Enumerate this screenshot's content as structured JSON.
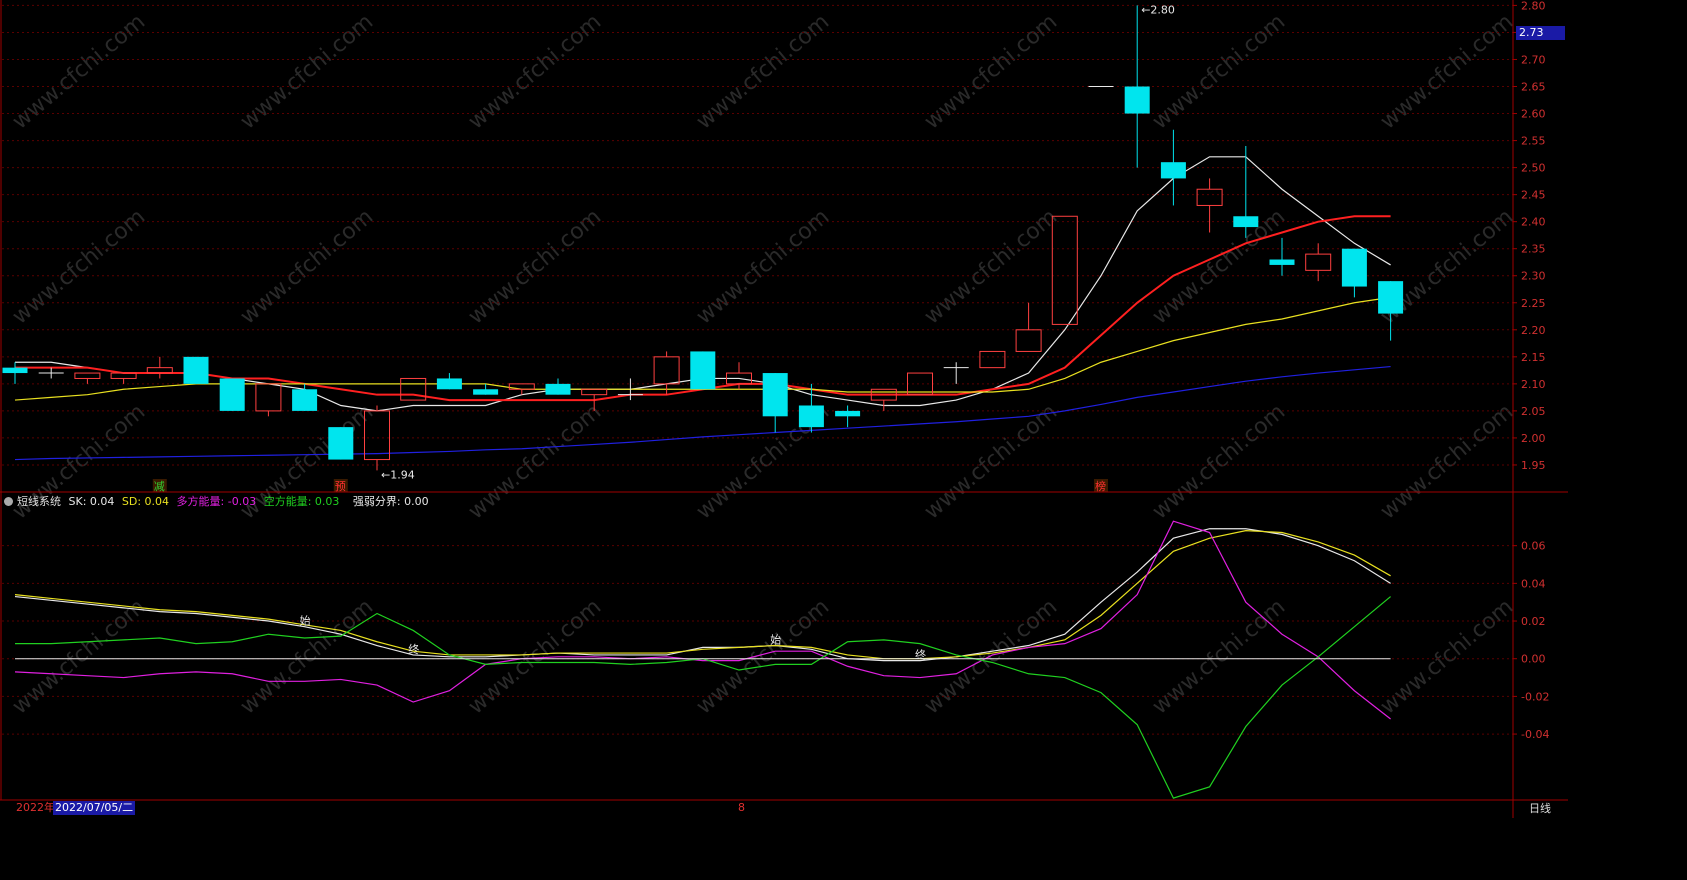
{
  "chart_data": [
    {
      "type": "candlestick",
      "title": "",
      "ylim": [
        1.9,
        2.81
      ],
      "y_ticks": [
        "1.95",
        "2.00",
        "2.05",
        "2.10",
        "2.15",
        "2.20",
        "2.25",
        "2.30",
        "2.35",
        "2.40",
        "2.45",
        "2.50",
        "2.55",
        "2.60",
        "2.65",
        "2.70",
        "2.75",
        "2.80"
      ],
      "grid": true,
      "candles": [
        {
          "o": 2.12,
          "h": 2.14,
          "l": 2.1,
          "c": 2.13,
          "dir": "down"
        },
        {
          "o": 2.12,
          "h": 2.13,
          "l": 2.11,
          "c": 2.12,
          "dir": "doji"
        },
        {
          "o": 2.11,
          "h": 2.12,
          "l": 2.1,
          "c": 2.12,
          "dir": "up"
        },
        {
          "o": 2.11,
          "h": 2.12,
          "l": 2.1,
          "c": 2.12,
          "dir": "up"
        },
        {
          "o": 2.12,
          "h": 2.15,
          "l": 2.11,
          "c": 2.13,
          "dir": "up"
        },
        {
          "o": 2.15,
          "h": 2.15,
          "l": 2.1,
          "c": 2.1,
          "dir": "down"
        },
        {
          "o": 2.11,
          "h": 2.11,
          "l": 2.05,
          "c": 2.05,
          "dir": "down"
        },
        {
          "o": 2.05,
          "h": 2.1,
          "l": 2.04,
          "c": 2.1,
          "dir": "up"
        },
        {
          "o": 2.09,
          "h": 2.1,
          "l": 2.05,
          "c": 2.05,
          "dir": "down"
        },
        {
          "o": 2.02,
          "h": 2.02,
          "l": 1.96,
          "c": 1.96,
          "dir": "down"
        },
        {
          "o": 1.96,
          "h": 2.06,
          "l": 1.94,
          "c": 2.05,
          "dir": "up"
        },
        {
          "o": 2.07,
          "h": 2.11,
          "l": 2.07,
          "c": 2.11,
          "dir": "up"
        },
        {
          "o": 2.11,
          "h": 2.12,
          "l": 2.09,
          "c": 2.09,
          "dir": "down"
        },
        {
          "o": 2.09,
          "h": 2.1,
          "l": 2.08,
          "c": 2.08,
          "dir": "down"
        },
        {
          "o": 2.09,
          "h": 2.1,
          "l": 2.08,
          "c": 2.1,
          "dir": "up"
        },
        {
          "o": 2.1,
          "h": 2.11,
          "l": 2.08,
          "c": 2.08,
          "dir": "down"
        },
        {
          "o": 2.08,
          "h": 2.09,
          "l": 2.05,
          "c": 2.09,
          "dir": "up"
        },
        {
          "o": 2.08,
          "h": 2.11,
          "l": 2.07,
          "c": 2.08,
          "dir": "doji"
        },
        {
          "o": 2.1,
          "h": 2.16,
          "l": 2.08,
          "c": 2.15,
          "dir": "up"
        },
        {
          "o": 2.16,
          "h": 2.16,
          "l": 2.09,
          "c": 2.09,
          "dir": "down"
        },
        {
          "o": 2.1,
          "h": 2.14,
          "l": 2.09,
          "c": 2.12,
          "dir": "up"
        },
        {
          "o": 2.12,
          "h": 2.12,
          "l": 2.01,
          "c": 2.04,
          "dir": "down"
        },
        {
          "o": 2.06,
          "h": 2.1,
          "l": 2.01,
          "c": 2.02,
          "dir": "down"
        },
        {
          "o": 2.05,
          "h": 2.06,
          "l": 2.02,
          "c": 2.04,
          "dir": "down"
        },
        {
          "o": 2.07,
          "h": 2.09,
          "l": 2.05,
          "c": 2.09,
          "dir": "up"
        },
        {
          "o": 2.08,
          "h": 2.12,
          "l": 2.08,
          "c": 2.12,
          "dir": "up"
        },
        {
          "o": 2.13,
          "h": 2.14,
          "l": 2.1,
          "c": 2.13,
          "dir": "doji"
        },
        {
          "o": 2.13,
          "h": 2.16,
          "l": 2.13,
          "c": 2.16,
          "dir": "up"
        },
        {
          "o": 2.16,
          "h": 2.25,
          "l": 2.16,
          "c": 2.2,
          "dir": "up"
        },
        {
          "o": 2.21,
          "h": 2.41,
          "l": 2.21,
          "c": 2.41,
          "dir": "up"
        },
        {
          "o": 2.65,
          "h": 2.65,
          "l": 2.65,
          "c": 2.65,
          "dir": "doji"
        },
        {
          "o": 2.65,
          "h": 2.8,
          "l": 2.5,
          "c": 2.6,
          "dir": "down"
        },
        {
          "o": 2.51,
          "h": 2.57,
          "l": 2.43,
          "c": 2.48,
          "dir": "down"
        },
        {
          "o": 2.43,
          "h": 2.48,
          "l": 2.38,
          "c": 2.46,
          "dir": "up"
        },
        {
          "o": 2.41,
          "h": 2.54,
          "l": 2.37,
          "c": 2.39,
          "dir": "down"
        },
        {
          "o": 2.33,
          "h": 2.37,
          "l": 2.3,
          "c": 2.32,
          "dir": "down"
        },
        {
          "o": 2.31,
          "h": 2.36,
          "l": 2.29,
          "c": 2.34,
          "dir": "up"
        },
        {
          "o": 2.35,
          "h": 2.35,
          "l": 2.26,
          "c": 2.28,
          "dir": "down"
        },
        {
          "o": 2.29,
          "h": 2.29,
          "l": 2.18,
          "c": 2.23,
          "dir": "down"
        }
      ],
      "series": [
        {
          "key": "ma_white",
          "color": "#e8e8e8",
          "values": [
            2.14,
            2.14,
            2.13,
            2.12,
            2.12,
            2.12,
            2.11,
            2.1,
            2.09,
            2.06,
            2.05,
            2.06,
            2.06,
            2.06,
            2.08,
            2.09,
            2.09,
            2.09,
            2.1,
            2.11,
            2.11,
            2.1,
            2.08,
            2.07,
            2.06,
            2.06,
            2.07,
            2.09,
            2.12,
            2.2,
            2.3,
            2.42,
            2.48,
            2.52,
            2.52,
            2.46,
            2.41,
            2.36,
            2.32
          ]
        },
        {
          "key": "ma_red",
          "color": "#ff2020",
          "values": [
            2.13,
            2.13,
            2.13,
            2.12,
            2.12,
            2.12,
            2.11,
            2.11,
            2.1,
            2.09,
            2.08,
            2.08,
            2.07,
            2.07,
            2.07,
            2.07,
            2.07,
            2.08,
            2.08,
            2.09,
            2.1,
            2.1,
            2.09,
            2.08,
            2.08,
            2.08,
            2.08,
            2.09,
            2.1,
            2.13,
            2.19,
            2.25,
            2.3,
            2.33,
            2.36,
            2.38,
            2.4,
            2.41,
            2.41
          ]
        },
        {
          "key": "ma_yellow",
          "color": "#e8e020",
          "values": [
            2.07,
            2.075,
            2.08,
            2.09,
            2.095,
            2.1,
            2.1,
            2.1,
            2.1,
            2.1,
            2.1,
            2.1,
            2.1,
            2.1,
            2.09,
            2.09,
            2.09,
            2.09,
            2.09,
            2.09,
            2.09,
            2.09,
            2.09,
            2.085,
            2.085,
            2.085,
            2.085,
            2.085,
            2.09,
            2.11,
            2.14,
            2.16,
            2.18,
            2.195,
            2.21,
            2.22,
            2.235,
            2.25,
            2.26
          ]
        },
        {
          "key": "ma_blue",
          "color": "#2020e0",
          "values": [
            1.96,
            1.962,
            1.963,
            1.964,
            1.965,
            1.966,
            1.967,
            1.968,
            1.969,
            1.97,
            1.971,
            1.973,
            1.975,
            1.978,
            1.98,
            1.984,
            1.988,
            1.992,
            1.997,
            2.002,
            2.006,
            2.01,
            2.014,
            2.018,
            2.022,
            2.026,
            2.03,
            2.035,
            2.04,
            2.05,
            2.062,
            2.075,
            2.085,
            2.095,
            2.105,
            2.113,
            2.12,
            2.126,
            2.132
          ]
        }
      ],
      "annotations": [
        {
          "text": "2.80",
          "candle": 31,
          "value": 2.8,
          "marker": "←"
        },
        {
          "text": "1.94",
          "candle": 10,
          "value": 1.94,
          "marker": "←"
        }
      ],
      "signals": [
        {
          "text": "减",
          "candle": 4,
          "color": "#30d030"
        },
        {
          "text": "预",
          "candle": 9,
          "color": "#ff3030"
        },
        {
          "text": "榜",
          "candle": 30,
          "color": "#ff3030"
        }
      ],
      "current_price": "2.73"
    },
    {
      "type": "line",
      "title": "短线系统",
      "ylim": [
        -0.075,
        0.08
      ],
      "y_ticks": [
        "-0.04",
        "-0.02",
        "0.00",
        "0.02",
        "0.04",
        "0.06"
      ],
      "zero_line": true,
      "legend": [
        {
          "label": "短线系统",
          "color": "#dddddd"
        },
        {
          "label": "SK: 0.04",
          "color": "#e8e8e8"
        },
        {
          "label": "SD: 0.04",
          "color": "#e8e020"
        },
        {
          "label": "多方能量: -0.03",
          "color": "#e020e0"
        },
        {
          "label": "空方能量: 0.03",
          "color": "#20d020"
        },
        {
          "label": "强弱分界: 0.00",
          "color": "#e8e8e8"
        }
      ],
      "series": [
        {
          "name": "SK",
          "color": "#e8e8e8",
          "values": [
            0.033,
            0.031,
            0.029,
            0.027,
            0.025,
            0.024,
            0.022,
            0.02,
            0.017,
            0.013,
            0.007,
            0.002,
            0.001,
            0.001,
            0.002,
            0.003,
            0.002,
            0.002,
            0.002,
            0.006,
            0.006,
            0.007,
            0.005,
            0.0,
            -0.001,
            -0.001,
            0.001,
            0.004,
            0.007,
            0.013,
            0.03,
            0.046,
            0.064,
            0.069,
            0.069,
            0.066,
            0.06,
            0.052,
            0.04
          ]
        },
        {
          "name": "SD",
          "color": "#e8e020",
          "values": [
            0.034,
            0.032,
            0.03,
            0.028,
            0.026,
            0.025,
            0.023,
            0.021,
            0.018,
            0.015,
            0.009,
            0.004,
            0.002,
            0.002,
            0.002,
            0.003,
            0.003,
            0.003,
            0.003,
            0.005,
            0.006,
            0.007,
            0.006,
            0.002,
            0.0,
            0.0,
            0.001,
            0.003,
            0.006,
            0.01,
            0.023,
            0.04,
            0.057,
            0.064,
            0.068,
            0.067,
            0.062,
            0.055,
            0.044
          ]
        },
        {
          "name": "多方能量",
          "color": "#e020e0",
          "values": [
            -0.007,
            -0.008,
            -0.009,
            -0.01,
            -0.008,
            -0.007,
            -0.008,
            -0.012,
            -0.012,
            -0.011,
            -0.014,
            -0.023,
            -0.017,
            -0.003,
            0.0,
            0.001,
            0.001,
            0.0,
            0.001,
            -0.001,
            -0.001,
            0.004,
            0.004,
            -0.004,
            -0.009,
            -0.01,
            -0.008,
            0.002,
            0.006,
            0.008,
            0.016,
            0.034,
            0.073,
            0.067,
            0.03,
            0.013,
            0.001,
            -0.017,
            -0.032
          ]
        },
        {
          "name": "空方能量",
          "color": "#20d020",
          "values": [
            0.008,
            0.008,
            0.009,
            0.01,
            0.011,
            0.008,
            0.009,
            0.013,
            0.011,
            0.012,
            0.024,
            0.015,
            0.002,
            -0.003,
            -0.002,
            -0.002,
            -0.002,
            -0.003,
            -0.002,
            0.0,
            -0.006,
            -0.003,
            -0.003,
            0.009,
            0.01,
            0.008,
            0.002,
            -0.002,
            -0.008,
            -0.01,
            -0.018,
            -0.035,
            -0.074,
            -0.068,
            -0.036,
            -0.014,
            0.001,
            0.017,
            0.033
          ]
        },
        {
          "name": "强弱分界",
          "color": "#e8e8e8",
          "values": [
            0.0
          ]
        }
      ],
      "annotations": [
        {
          "text": "始",
          "candle": 8
        },
        {
          "text": "终",
          "candle": 11
        },
        {
          "text": "始",
          "candle": 21
        },
        {
          "text": "终",
          "candle": 25
        }
      ]
    }
  ],
  "footer": {
    "year_label": "2022年",
    "date_label": "2022/07/05/二",
    "month_label": "8",
    "period_label": "日线"
  },
  "watermark": "www.cfchi.com"
}
